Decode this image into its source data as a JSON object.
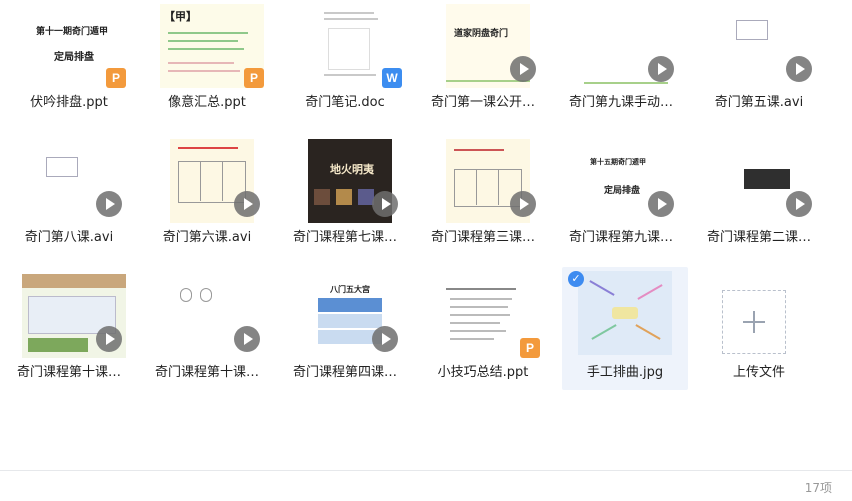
{
  "files": [
    {
      "name": "伏吟排盘.ppt",
      "type": "ppt",
      "preview": [
        "第十一期奇门遁甲",
        "定局排盘"
      ]
    },
    {
      "name": "像意汇总.ppt",
      "type": "ppt",
      "preview": [
        "【甲】"
      ]
    },
    {
      "name": "奇门笔记.doc",
      "type": "doc"
    },
    {
      "name": "奇门第一课公开…",
      "type": "video",
      "preview": [
        "道家阴盘奇门"
      ]
    },
    {
      "name": "奇门第九课手动…",
      "type": "video"
    },
    {
      "name": "奇门第五课.avi",
      "type": "video"
    },
    {
      "name": "奇门第八课.avi",
      "type": "video"
    },
    {
      "name": "奇门第六课.avi",
      "type": "video"
    },
    {
      "name": "奇门课程第七课…",
      "type": "video",
      "preview": [
        "地火明夷"
      ]
    },
    {
      "name": "奇门课程第三课…",
      "type": "video"
    },
    {
      "name": "奇门课程第九课…",
      "type": "video",
      "preview": [
        "第十五期奇门遁甲",
        "定局排盘"
      ]
    },
    {
      "name": "奇门课程第二课…",
      "type": "video"
    },
    {
      "name": "奇门课程第十课…",
      "type": "video"
    },
    {
      "name": "奇门课程第十课…",
      "type": "video"
    },
    {
      "name": "奇门课程第四课…",
      "type": "video",
      "preview": [
        "八门五大宫"
      ]
    },
    {
      "name": "小技巧总结.ppt",
      "type": "ppt"
    },
    {
      "name": "手工排曲.jpg",
      "type": "jpg",
      "selected": true
    },
    {
      "name": "上传文件",
      "type": "upload"
    }
  ],
  "badges": {
    "ppt": "P",
    "doc": "W"
  },
  "footer": {
    "count": "17项"
  }
}
